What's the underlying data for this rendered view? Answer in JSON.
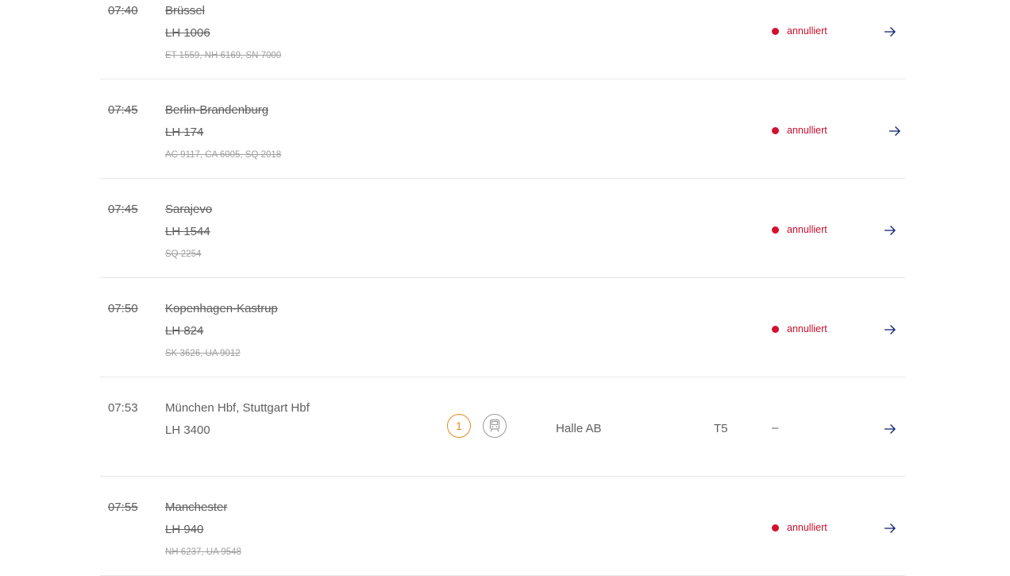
{
  "flights": [
    {
      "time": "07:40",
      "destination": "Brüssel",
      "flight_number": "LH 1006",
      "codeshares": "ET 1559, NH 6169, SN 7000",
      "status": "annulliert",
      "cancelled": true
    },
    {
      "time": "07:45",
      "destination": "Berlin-Brandenburg",
      "flight_number": "LH 174",
      "codeshares": "AC 9117, CA 6005, SQ 2018",
      "status": "annulliert",
      "cancelled": true
    },
    {
      "time": "07:45",
      "destination": "Sarajevo",
      "flight_number": "LH 1544",
      "codeshares": "SQ 2254",
      "status": "annulliert",
      "cancelled": true
    },
    {
      "time": "07:50",
      "destination": "Kopenhagen-Kastrup",
      "flight_number": "LH 824",
      "codeshares": "SK 3626, UA 9012",
      "status": "annulliert",
      "cancelled": true
    },
    {
      "time": "07:53",
      "destination": "München Hbf, Stuttgart Hbf",
      "flight_number": "LH 3400",
      "codeshares": "",
      "gate": "1",
      "transport_icon": "train-icon",
      "location": "Halle AB",
      "terminal": "T5",
      "status": "–",
      "cancelled": false
    },
    {
      "time": "07:55",
      "destination": "Manchester",
      "flight_number": "LH 940",
      "codeshares": "NH 6237, UA 9548",
      "status": "annulliert",
      "cancelled": true
    }
  ],
  "icons": {
    "status_dot": "status-dot-icon",
    "details_arrow": "arrow-right-icon"
  },
  "colors": {
    "cancelled_status": "#c8102e",
    "arrow": "#0a1d6e",
    "gate_accent": "#e48a23",
    "text": "#5f5f5f",
    "codeshare_text": "#a0a0a0",
    "divider": "#e6e6e6"
  }
}
